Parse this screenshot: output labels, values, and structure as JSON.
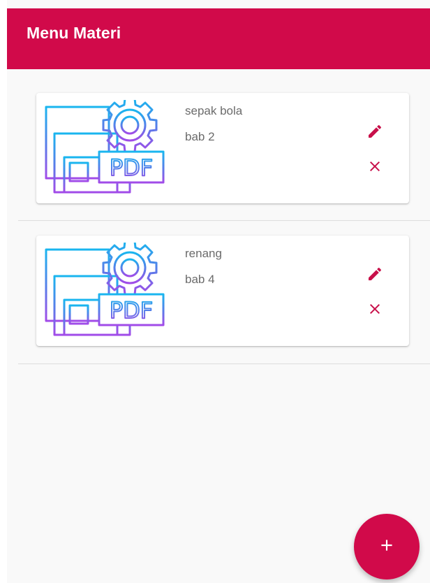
{
  "app": {
    "title": "Menu Materi",
    "accent_color": "#d10a4a"
  },
  "materials": [
    {
      "title": "sepak bola",
      "subtitle": "bab 2",
      "thumbnail_icon": "pdf-settings-icon"
    },
    {
      "title": "renang",
      "subtitle": "bab 4",
      "thumbnail_icon": "pdf-settings-icon"
    }
  ],
  "thumbnail": {
    "badge_text": "PDF"
  },
  "actions": {
    "edit_icon": "pencil-icon",
    "delete_icon": "close-icon",
    "add_icon": "plus-icon"
  }
}
